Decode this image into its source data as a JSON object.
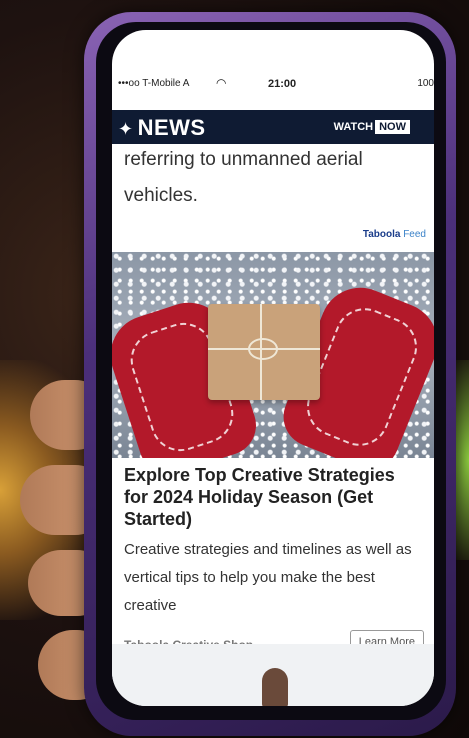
{
  "status_bar": {
    "carrier": "•••oo T-Mobile A",
    "wifi_icon": "wifi-icon",
    "time": "21:00",
    "battery": "100"
  },
  "nav": {
    "logo_icon": "peacock-icon",
    "logo_text": "NEWS",
    "watch_label": "WATCH",
    "now_label": "NOW"
  },
  "article": {
    "text_line1": "referring to unmanned aerial",
    "text_line2": "vehicles."
  },
  "feed": {
    "brand": "Taboola",
    "label": "Feed"
  },
  "ad": {
    "title": "Explore Top Creative Strategies for 2024 Holiday Season (Get Started)",
    "description": "Creative strategies and timelines as well as vertical tips to help you make the best creative",
    "advertiser": "Taboola Creative Shop",
    "cta_label": "Learn More"
  }
}
